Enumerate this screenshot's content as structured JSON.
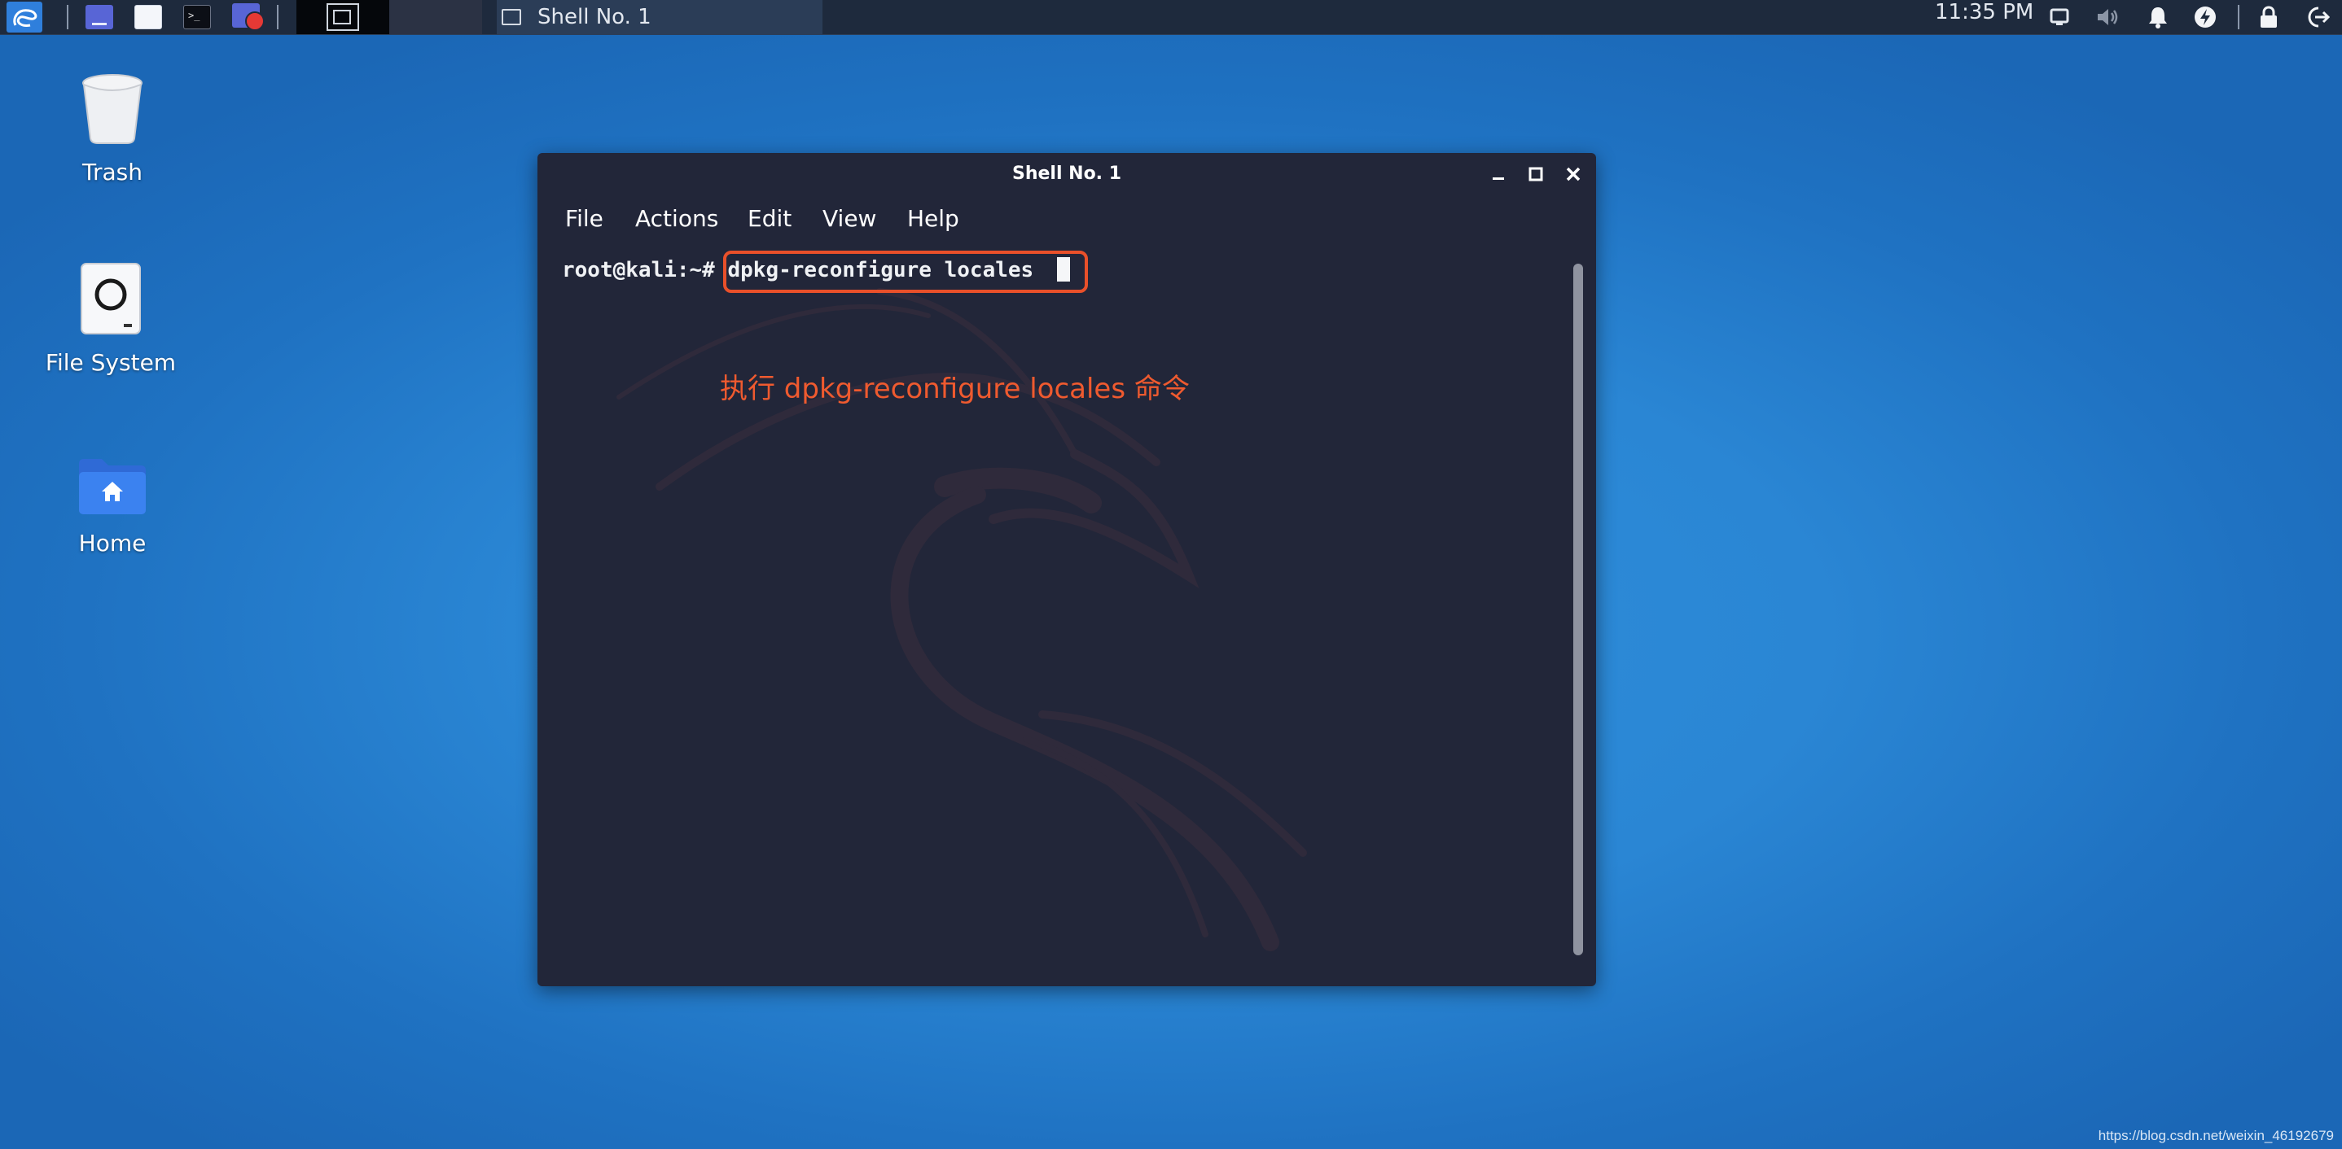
{
  "panel": {
    "window_title": "Shell No. 1",
    "clock": "11:35 PM"
  },
  "desktop": {
    "icons": [
      {
        "label": "Trash"
      },
      {
        "label": "File System"
      },
      {
        "label": "Home"
      }
    ]
  },
  "terminal": {
    "title": "Shell No. 1",
    "menu": [
      "File",
      "Actions",
      "Edit",
      "View",
      "Help"
    ],
    "prompt": "root@kali:~#",
    "command": "dpkg-reconfigure locales",
    "annotation": "执行 dpkg-reconfigure locales 命令"
  },
  "watermark": "https://blog.csdn.net/weixin_46192679",
  "colors": {
    "desktop": "#2a86d4",
    "panel": "#1e2a3d",
    "terminal_bg": "#222639",
    "highlight": "#e9502a"
  }
}
